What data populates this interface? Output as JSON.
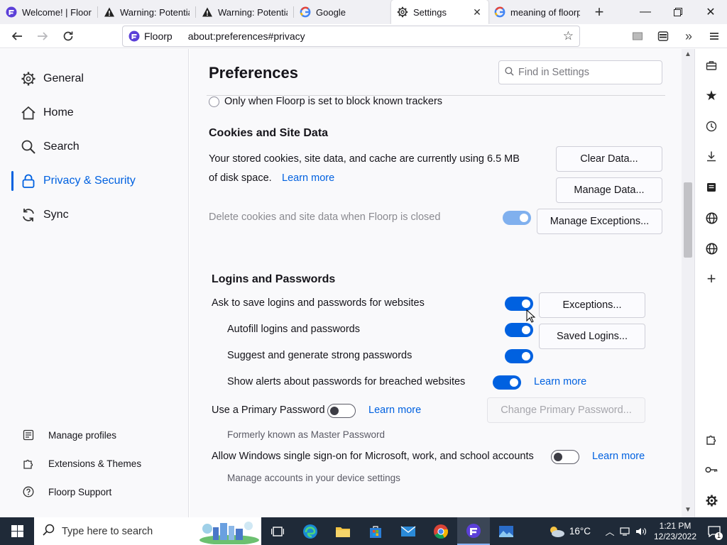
{
  "tabs": [
    {
      "title": "Welcome! | Floorp",
      "icon": "floorp-icon"
    },
    {
      "title": "Warning: Potential",
      "icon": "warning-icon"
    },
    {
      "title": "Warning: Potential",
      "icon": "warning-icon"
    },
    {
      "title": "Google",
      "icon": "google-icon"
    },
    {
      "title": "Settings",
      "icon": "gear-icon",
      "active": true
    },
    {
      "title": "meaning of floorp",
      "icon": "google-icon"
    }
  ],
  "urlbar": {
    "brand": "Floorp",
    "url": "about:preferences#privacy"
  },
  "categories": [
    {
      "label": "General",
      "icon": "gear-icon"
    },
    {
      "label": "Home",
      "icon": "home-icon"
    },
    {
      "label": "Search",
      "icon": "search-icon"
    },
    {
      "label": "Privacy & Security",
      "icon": "lock-icon",
      "selected": true
    },
    {
      "label": "Sync",
      "icon": "sync-icon"
    }
  ],
  "footer_links": [
    {
      "label": "Manage profiles",
      "icon": "profile-icon"
    },
    {
      "label": "Extensions & Themes",
      "icon": "puzzle-icon"
    },
    {
      "label": "Floorp Support",
      "icon": "help-icon"
    }
  ],
  "page": {
    "title": "Preferences",
    "search_placeholder": "Find in Settings",
    "tracker_radio": "Only when Floorp is set to block known trackers",
    "cookies": {
      "heading": "Cookies and Site Data",
      "desc_line1": "Your stored cookies, site data, and cache are currently using 6.5 MB",
      "desc_line2": "of disk space.",
      "learn_more": "Learn more",
      "clear_data": "Clear Data...",
      "manage_data": "Manage Data...",
      "delete_on_close": "Delete cookies and site data when Floorp is closed",
      "manage_exceptions": "Manage Exceptions..."
    },
    "logins": {
      "heading": "Logins and Passwords",
      "ask_save": "Ask to save logins and passwords for websites",
      "exceptions": "Exceptions...",
      "autofill": "Autofill logins and passwords",
      "saved_logins": "Saved Logins...",
      "suggest": "Suggest and generate strong passwords",
      "breach_alerts": "Show alerts about passwords for breached websites",
      "breach_learn_more": "Learn more",
      "primary_password": "Use a Primary Password",
      "primary_learn_more": "Learn more",
      "change_primary": "Change Primary Password...",
      "formerly": "Formerly known as Master Password",
      "windows_sso": "Allow Windows single sign-on for Microsoft, work, and school accounts",
      "sso_learn_more": "Learn more",
      "manage_accounts": "Manage accounts in your device settings"
    }
  },
  "taskbar": {
    "search_placeholder": "Type here to search",
    "weather": "16°C",
    "time": "1:21 PM",
    "date": "12/23/2022",
    "notification_count": "1"
  },
  "colors": {
    "accent": "#0061e0",
    "taskbar": "#1f2a38"
  }
}
